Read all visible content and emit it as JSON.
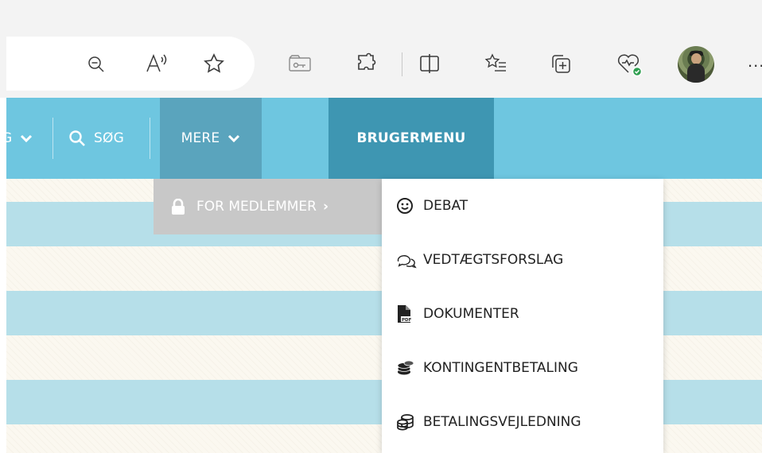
{
  "browser": {
    "icons": [
      "zoom-out-icon",
      "read-aloud-icon",
      "favorite-star-icon",
      "password-key-icon",
      "extensions-icon",
      "split-screen-icon",
      "favorites-list-icon",
      "collections-icon",
      "browser-essentials-icon",
      "profile-avatar",
      "more-options-icon"
    ],
    "more_label": "..."
  },
  "navbar": {
    "partial_item_label": "G",
    "search_label": "SØG",
    "mere_label": "MERE",
    "brugermenu_label": "BRUGERMENU",
    "colors": {
      "bar": "#6ec6e0",
      "active": "#5aa4bd",
      "brugermenu": "#3e96b2"
    }
  },
  "submenu": {
    "for_medlemmer_label": "FOR MEDLEMMER",
    "chevron": "›"
  },
  "members_menu": {
    "items": [
      {
        "label": "DEBAT",
        "icon": "smiley-icon"
      },
      {
        "label": "VEDTÆGTSFORSLAG",
        "icon": "chat-bubbles-icon"
      },
      {
        "label": "DOKUMENTER",
        "icon": "pdf-file-icon"
      },
      {
        "label": "KONTINGENTBETALING",
        "icon": "coins-icon"
      },
      {
        "label": "BETALINGSVEJLEDNING",
        "icon": "coin-stack-icon"
      }
    ]
  }
}
